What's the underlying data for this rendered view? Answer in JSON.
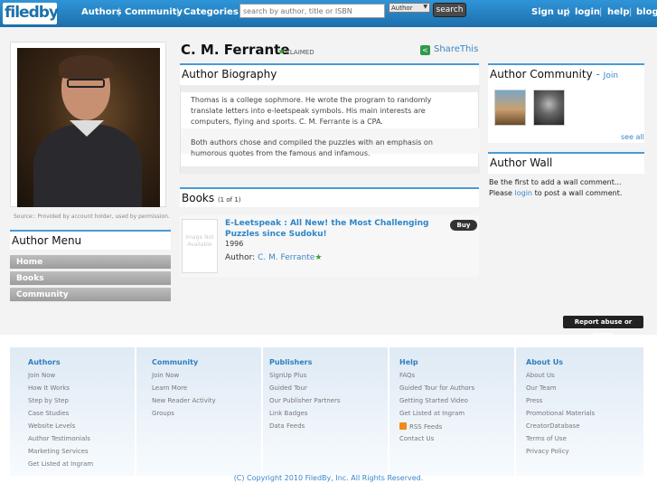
{
  "header": {
    "logo": "filedby",
    "nav": [
      "Authors",
      "Community",
      "Categories"
    ],
    "search": {
      "placeholder": "search by author, title or ISBN",
      "scope": "Author",
      "button": "search"
    },
    "account": [
      "Sign up",
      "login",
      "help",
      "blog"
    ]
  },
  "author": {
    "name": "C. M. Ferrante",
    "claimed_label": "CLAIMED",
    "share_label": "ShareThis",
    "photo_caption": "Source:: Provided by account holder, used by permission."
  },
  "menu": {
    "title": "Author Menu",
    "items": [
      "Home",
      "Books",
      "Community"
    ]
  },
  "biography": {
    "title": "Author Biography",
    "paragraphs": [
      "Thomas is a college sophmore. He wrote the program to randomly translate letters into e-leetspeak symbols. His main interests are computers, flying and sports. C. M. Ferrante is a CPA.",
      "Both authors chose and compiled the puzzles with an emphasis on humorous quotes from the famous and infamous."
    ]
  },
  "books": {
    "title": "Books",
    "count": "(1 of 1)",
    "items": [
      {
        "title": "E-Leetspeak : All New! the Most Challenging Puzzles since Sudoku!",
        "year": "1996",
        "author_label": "Author:",
        "author": "C. M. Ferrante",
        "buy": "Buy",
        "cover_placeholder": "Image Not Available"
      }
    ]
  },
  "community": {
    "title": "Author Community",
    "join": "Join",
    "see_all": "see all"
  },
  "wall": {
    "title": "Author Wall",
    "line1": "Be the first to add a wall comment...",
    "line2_prefix": "Please",
    "line2_link": "login",
    "line2_suffix": "to post a wall comment."
  },
  "report_button": "Report abuse or errors",
  "footer": {
    "columns": [
      {
        "title": "Authors",
        "links": [
          "Join Now",
          "How It Works",
          "Step by Step",
          "Case Studies",
          "Website Levels",
          "Author Testimonials",
          "Marketing Services",
          "Get Listed at Ingram"
        ]
      },
      {
        "title": "Community",
        "links": [
          "Join Now",
          "Learn More",
          "New Reader Activity",
          "Groups"
        ]
      },
      {
        "title": "Publishers",
        "links": [
          "SignUp Plus",
          "Guided Tour",
          "Our Publisher Partners",
          "Link Badges",
          "Data Feeds"
        ]
      },
      {
        "title": "Help",
        "links": [
          "FAQs",
          "Guided Tour for Authors",
          "Getting Started Video",
          "Get Listed at Ingram",
          "RSS Feeds",
          "Contact Us"
        ]
      },
      {
        "title": "About Us",
        "links": [
          "About Us",
          "Our Team",
          "Press",
          "Promotional Materials",
          "CreatorDatabase",
          "Terms of Use",
          "Privacy Policy"
        ]
      }
    ],
    "copyright": "(C) Copyright 2010 FiledBy, Inc. All Rights Reserved."
  },
  "colors": {
    "header_blue": "#2f95d8",
    "accent_blue": "#4a9ad6",
    "link_blue": "#3a86c8",
    "claimed_star": "#3aa03a"
  },
  "icons": [
    "share-icon",
    "star-icon",
    "rss-icon"
  ]
}
